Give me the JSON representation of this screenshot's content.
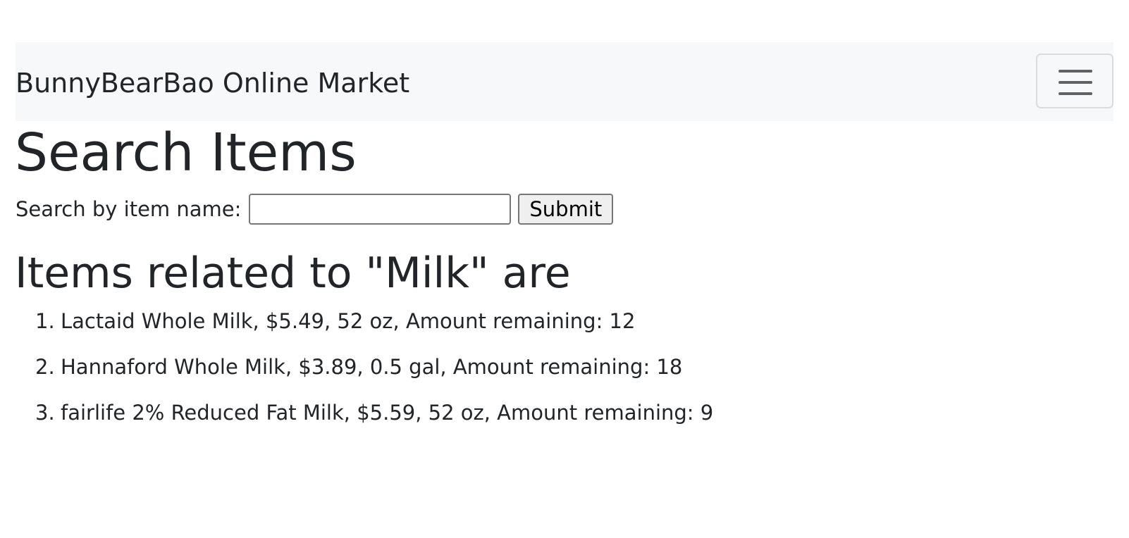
{
  "navbar": {
    "brand": "BunnyBearBao Online Market",
    "toggler_icon": "hamburger-menu-icon"
  },
  "page": {
    "title": "Search Items"
  },
  "search": {
    "label": "Search by item name:",
    "value": "",
    "placeholder": "",
    "submit_label": "Submit"
  },
  "results": {
    "heading": "Items related to \"Milk\" are",
    "items": [
      {
        "number": "1.",
        "text": "Lactaid Whole Milk, $5.49, 52 oz, Amount remaining: 12"
      },
      {
        "number": "2.",
        "text": "Hannaford Whole Milk, $3.89, 0.5 gal, Amount remaining: 18"
      },
      {
        "number": "3.",
        "text": "fairlife 2% Reduced Fat Milk, $5.59, 52 oz, Amount remaining: 9"
      }
    ]
  }
}
